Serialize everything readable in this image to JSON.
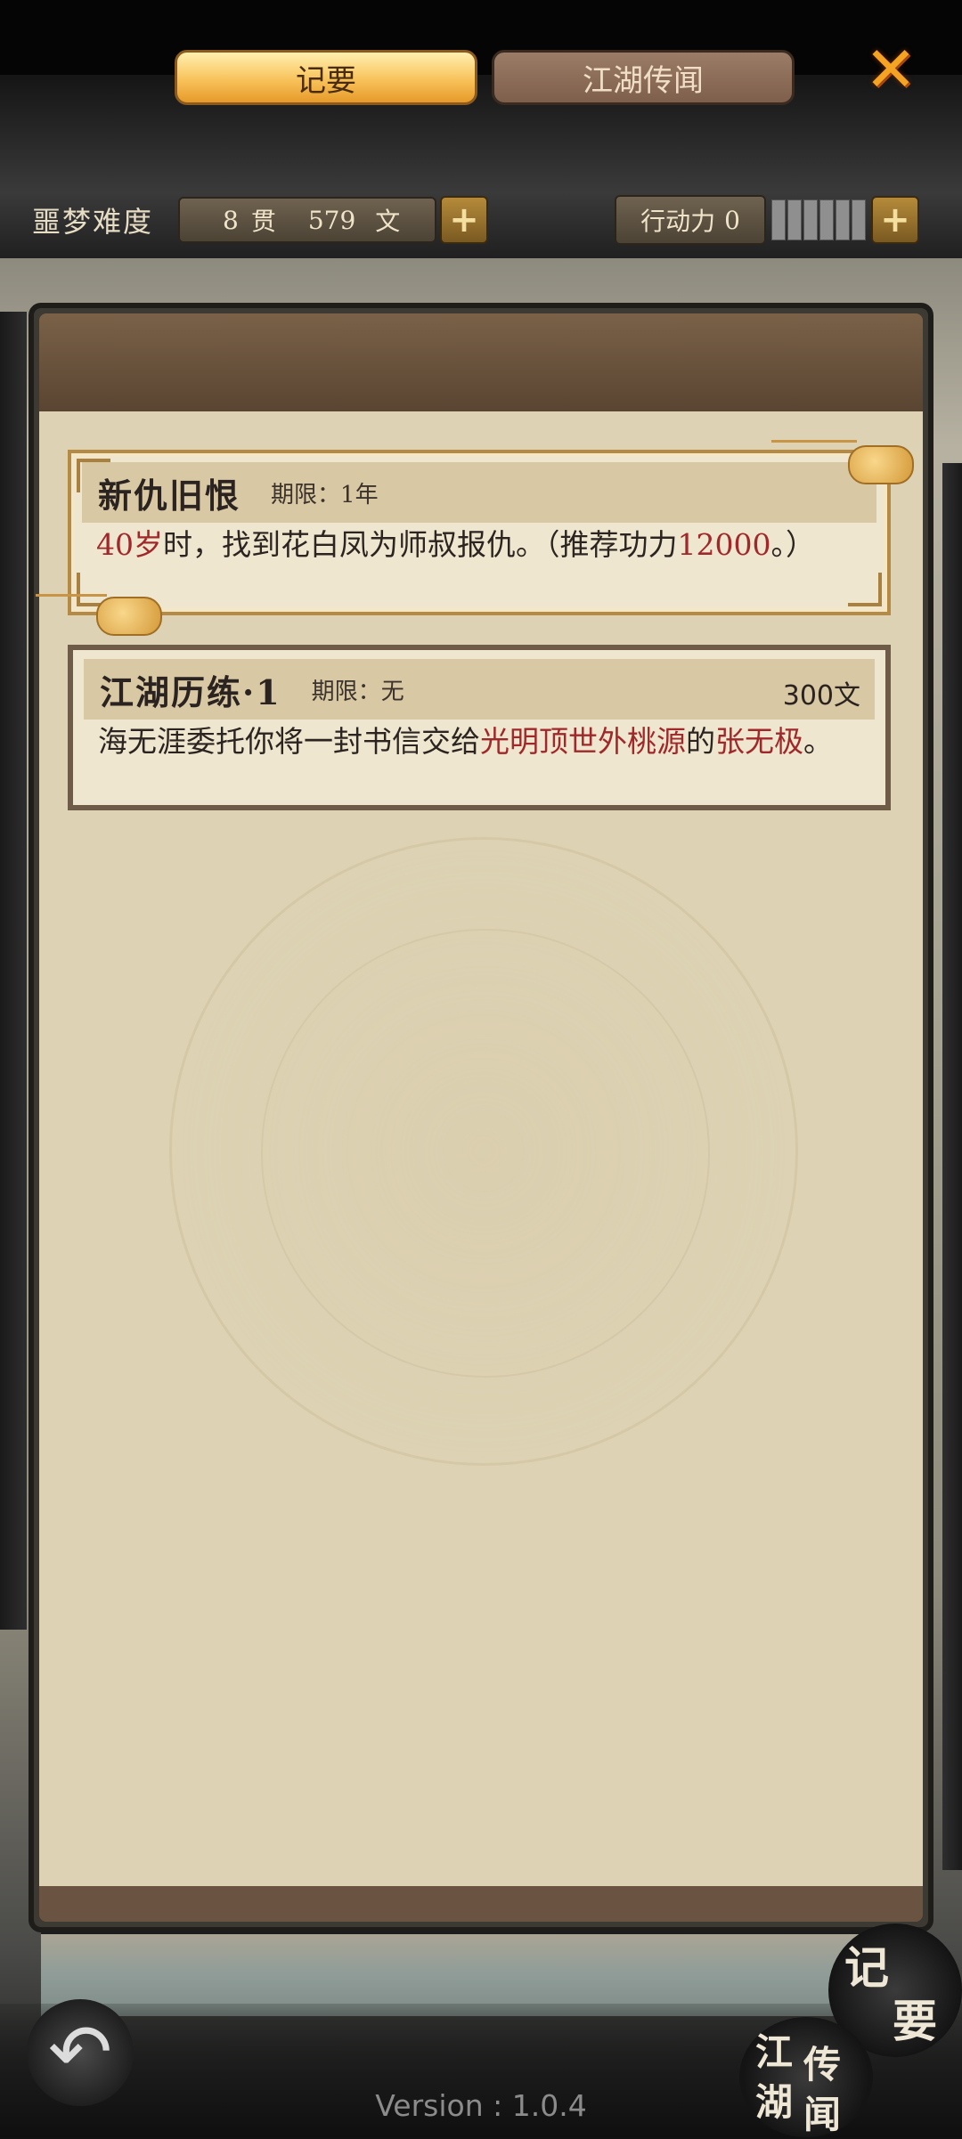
{
  "status_bar": {
    "difficulty_label": "噩梦难度",
    "money": {
      "guan_value": "8",
      "guan_unit": "贯",
      "wen_value": "579",
      "wen_unit": "文"
    },
    "action": {
      "label": "行动力",
      "value": "0",
      "level_fraction": 0
    }
  },
  "tabs": [
    {
      "label": "记要",
      "active": true
    },
    {
      "label": "江湖传闻",
      "active": false
    }
  ],
  "quests": [
    {
      "title": "新仇旧恨",
      "limit_label": "期限：",
      "limit_value": "1年",
      "desc_parts": [
        {
          "text": "40岁",
          "color": "red"
        },
        {
          "text": "时，找到花白凤为师叔报仇。（推荐功力",
          "color": "normal"
        },
        {
          "text": "12000",
          "color": "red"
        },
        {
          "text": "。）",
          "color": "normal"
        }
      ]
    },
    {
      "title": "江湖历练·1",
      "limit_label": "期限：",
      "limit_value": "无",
      "reward": "300文",
      "desc_parts": [
        {
          "text": "海无涯委托你将一封书信交给",
          "color": "normal"
        },
        {
          "text": "光明顶世外桃源",
          "color": "red"
        },
        {
          "text": "的",
          "color": "normal"
        },
        {
          "text": "张无极",
          "color": "red"
        },
        {
          "text": "。",
          "color": "normal"
        }
      ]
    }
  ],
  "bottom_nav": {
    "back_icon": "back-arrow-icon",
    "jiyao_chars": [
      "记",
      "要"
    ],
    "jianghu_chars": [
      "江",
      "湖",
      "传",
      "闻"
    ]
  },
  "version": "Version : 1.0.4",
  "colors": {
    "accent_red": "#a0282a",
    "tab_active": "#f8c25a",
    "panel_bg": "#ddd3b4"
  }
}
